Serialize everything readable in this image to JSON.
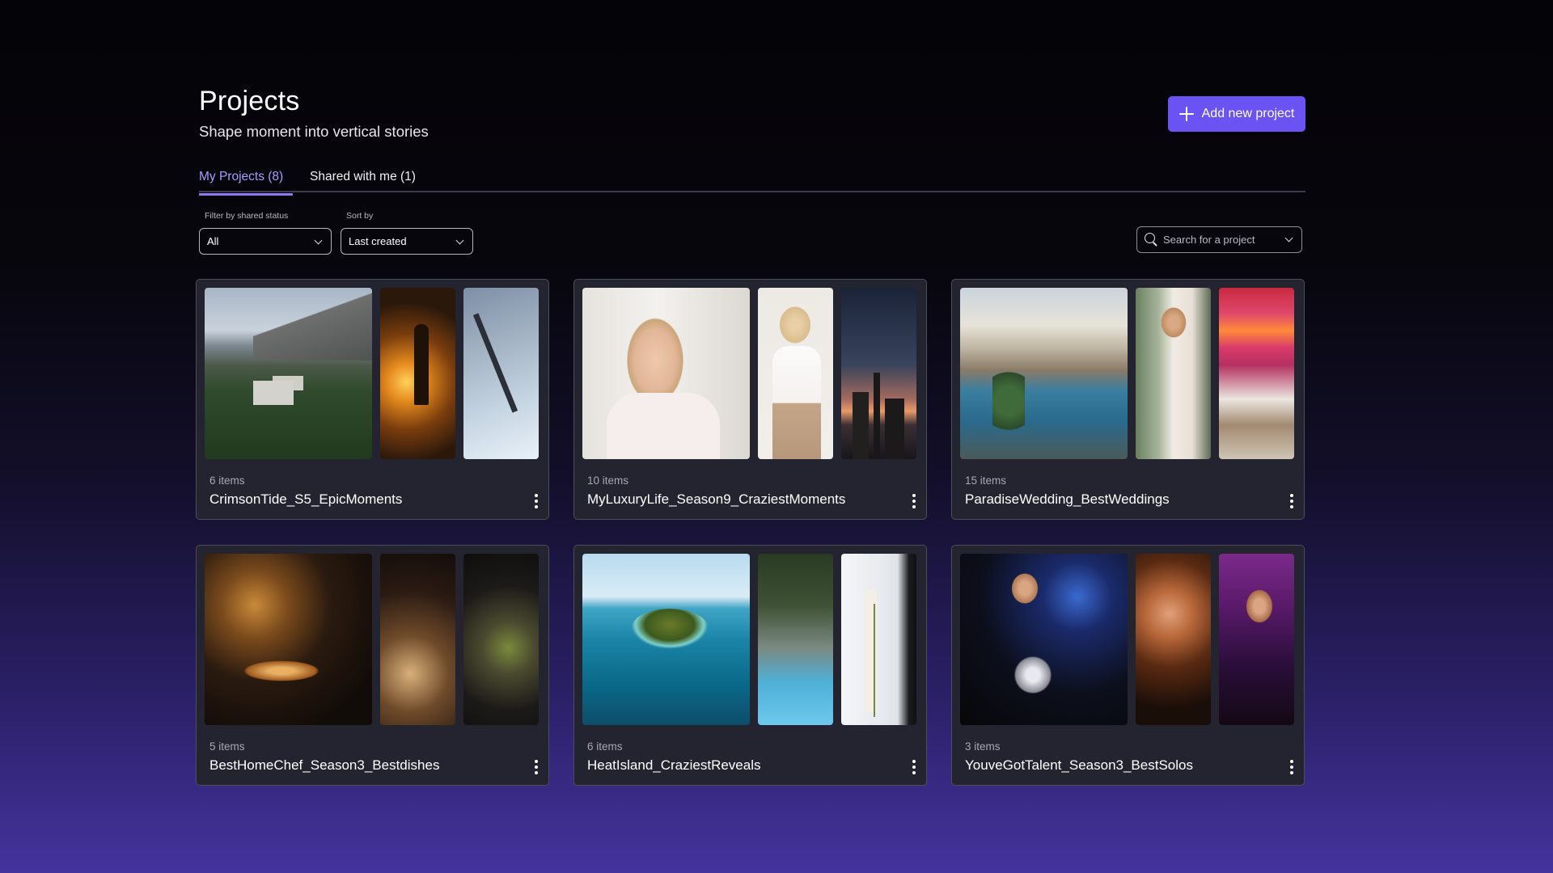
{
  "header": {
    "title": "Projects",
    "subtitle": "Shape moment into vertical stories",
    "add_button_label": "Add new project"
  },
  "tabs": [
    {
      "label": "My Projects (8)",
      "active": true
    },
    {
      "label": "Shared with me (1)",
      "active": false
    }
  ],
  "filters": {
    "shared_status": {
      "label": "Filter by shared status",
      "value": "All"
    },
    "sort": {
      "label": "Sort by",
      "value": "Last created"
    }
  },
  "search": {
    "placeholder": "Search for a project"
  },
  "projects": [
    {
      "count": "6 items",
      "name": "CrimsonTide_S5_EpicMoments",
      "thumbs": [
        "castle-landscape",
        "sunset-warrior",
        "sword-in-snow"
      ]
    },
    {
      "count": "10 items",
      "name": "MyLuxuryLife_Season9_CraziestMoments",
      "thumbs": [
        "woman-champagne",
        "blonde-woman",
        "city-skyline-sunset"
      ]
    },
    {
      "count": "15 items",
      "name": "ParadiseWedding_BestWeddings",
      "thumbs": [
        "wedding-pool-venue",
        "bride",
        "wedding-mandap"
      ]
    },
    {
      "count": "5 items",
      "name": "BestHomeChef_Season3_Bestdishes",
      "thumbs": [
        "chef-pan",
        "plating-food",
        "cooking-pan"
      ]
    },
    {
      "count": "6 items",
      "name": "HeatIsland_CraziestReveals",
      "thumbs": [
        "tropical-island",
        "palm-pool",
        "man-with-rose"
      ]
    },
    {
      "count": "3 items",
      "name": "YouveGotTalent_Season3_BestSolos",
      "thumbs": [
        "guitarist-stage",
        "singer",
        "violinist"
      ]
    }
  ],
  "colors": {
    "accent": "#6b52f3",
    "active_tab": "#a79cff",
    "card_bg": "#242330"
  }
}
